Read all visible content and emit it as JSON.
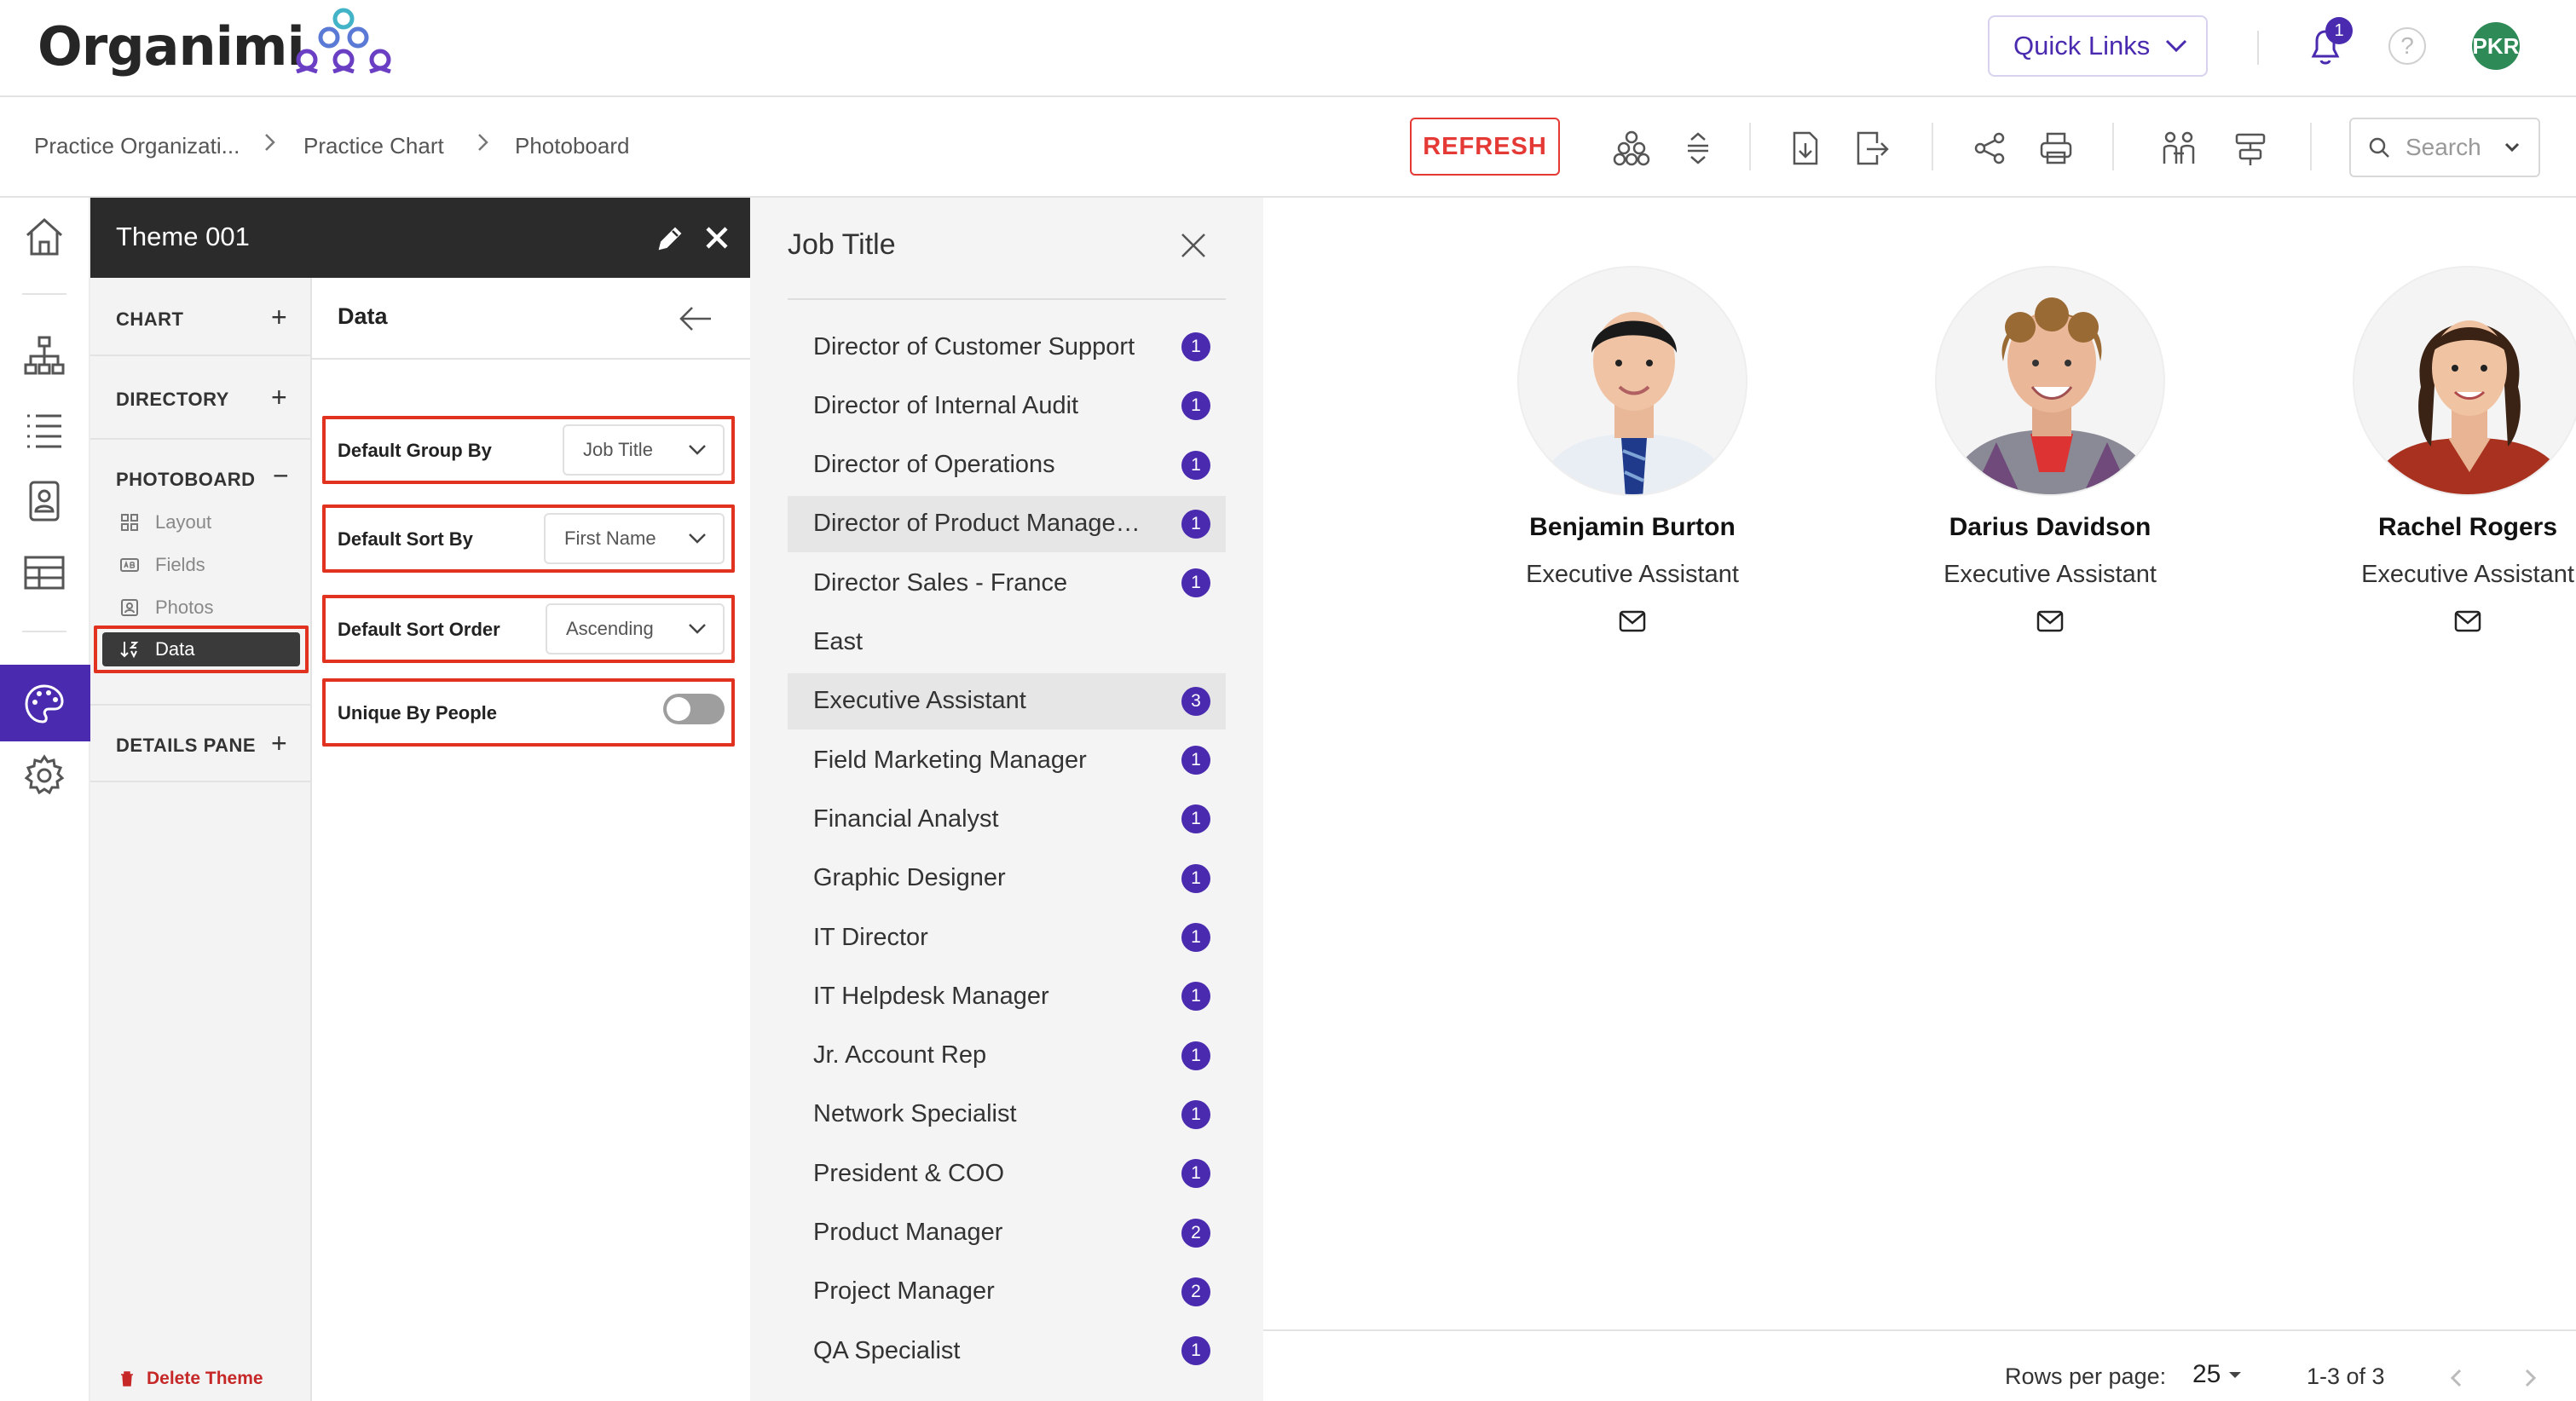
{
  "header": {
    "logo_text": "Organimi",
    "quick_links_label": "Quick Links",
    "notification_count": "1",
    "help_glyph": "?",
    "avatar_initials": "PKR"
  },
  "breadcrumbs": [
    "Practice Organizati...",
    "Practice Chart",
    "Photoboard"
  ],
  "toolbar": {
    "refresh_label": "REFRESH",
    "search_placeholder": "Search",
    "icons": [
      "org-chart-icon",
      "collapse-icon",
      "import-icon",
      "export-icon",
      "share-icon",
      "print-icon",
      "people-icon",
      "align-icon"
    ]
  },
  "theme": {
    "title": "Theme 001",
    "sections": {
      "chart": "CHART",
      "directory": "DIRECTORY",
      "photoboard": "PHOTOBOARD",
      "details_pane": "DETAILS PANE"
    },
    "photoboard_items": [
      "Layout",
      "Fields",
      "Photos",
      "Data"
    ],
    "selected_item": "Data",
    "delete_label": "Delete Theme"
  },
  "data_panel": {
    "title": "Data",
    "group_by": {
      "label": "Default Group By",
      "value": "Job Title"
    },
    "sort_by": {
      "label": "Default Sort By",
      "value": "First Name"
    },
    "sort_order": {
      "label": "Default Sort Order",
      "value": "Ascending"
    },
    "unique": {
      "label": "Unique By People",
      "enabled": false
    }
  },
  "job_panel": {
    "title": "Job Title",
    "items": [
      {
        "name": "Director of Customer Support",
        "count": "1"
      },
      {
        "name": "Director of Internal Audit",
        "count": "1"
      },
      {
        "name": "Director of Operations",
        "count": "1"
      },
      {
        "name": "Director of Product Management",
        "count": "1"
      },
      {
        "name": "Director Sales - France",
        "count": "1"
      },
      {
        "name": "East",
        "count": ""
      },
      {
        "name": "Executive Assistant",
        "count": "3"
      },
      {
        "name": "Field Marketing Manager",
        "count": "1"
      },
      {
        "name": "Financial Analyst",
        "count": "1"
      },
      {
        "name": "Graphic Designer",
        "count": "1"
      },
      {
        "name": "IT Director",
        "count": "1"
      },
      {
        "name": "IT Helpdesk Manager",
        "count": "1"
      },
      {
        "name": "Jr. Account Rep",
        "count": "1"
      },
      {
        "name": "Network Specialist",
        "count": "1"
      },
      {
        "name": "President & COO",
        "count": "1"
      },
      {
        "name": "Product Manager",
        "count": "2"
      },
      {
        "name": "Project Manager",
        "count": "2"
      },
      {
        "name": "QA Specialist",
        "count": "1"
      }
    ]
  },
  "board": {
    "people": [
      {
        "name": "Benjamin Burton",
        "title": "Executive Assistant"
      },
      {
        "name": "Darius Davidson",
        "title": "Executive Assistant"
      },
      {
        "name": "Rachel Rogers",
        "title": "Executive Assistant"
      }
    ],
    "rows_per_page_label": "Rows per page:",
    "rows_per_page": "25",
    "range": "1-3 of 3"
  },
  "colors": {
    "accent": "#4a2bb0",
    "refresh_red": "#e53935",
    "highlight_red": "#e0321e",
    "dark_header": "#2b2b2b"
  }
}
